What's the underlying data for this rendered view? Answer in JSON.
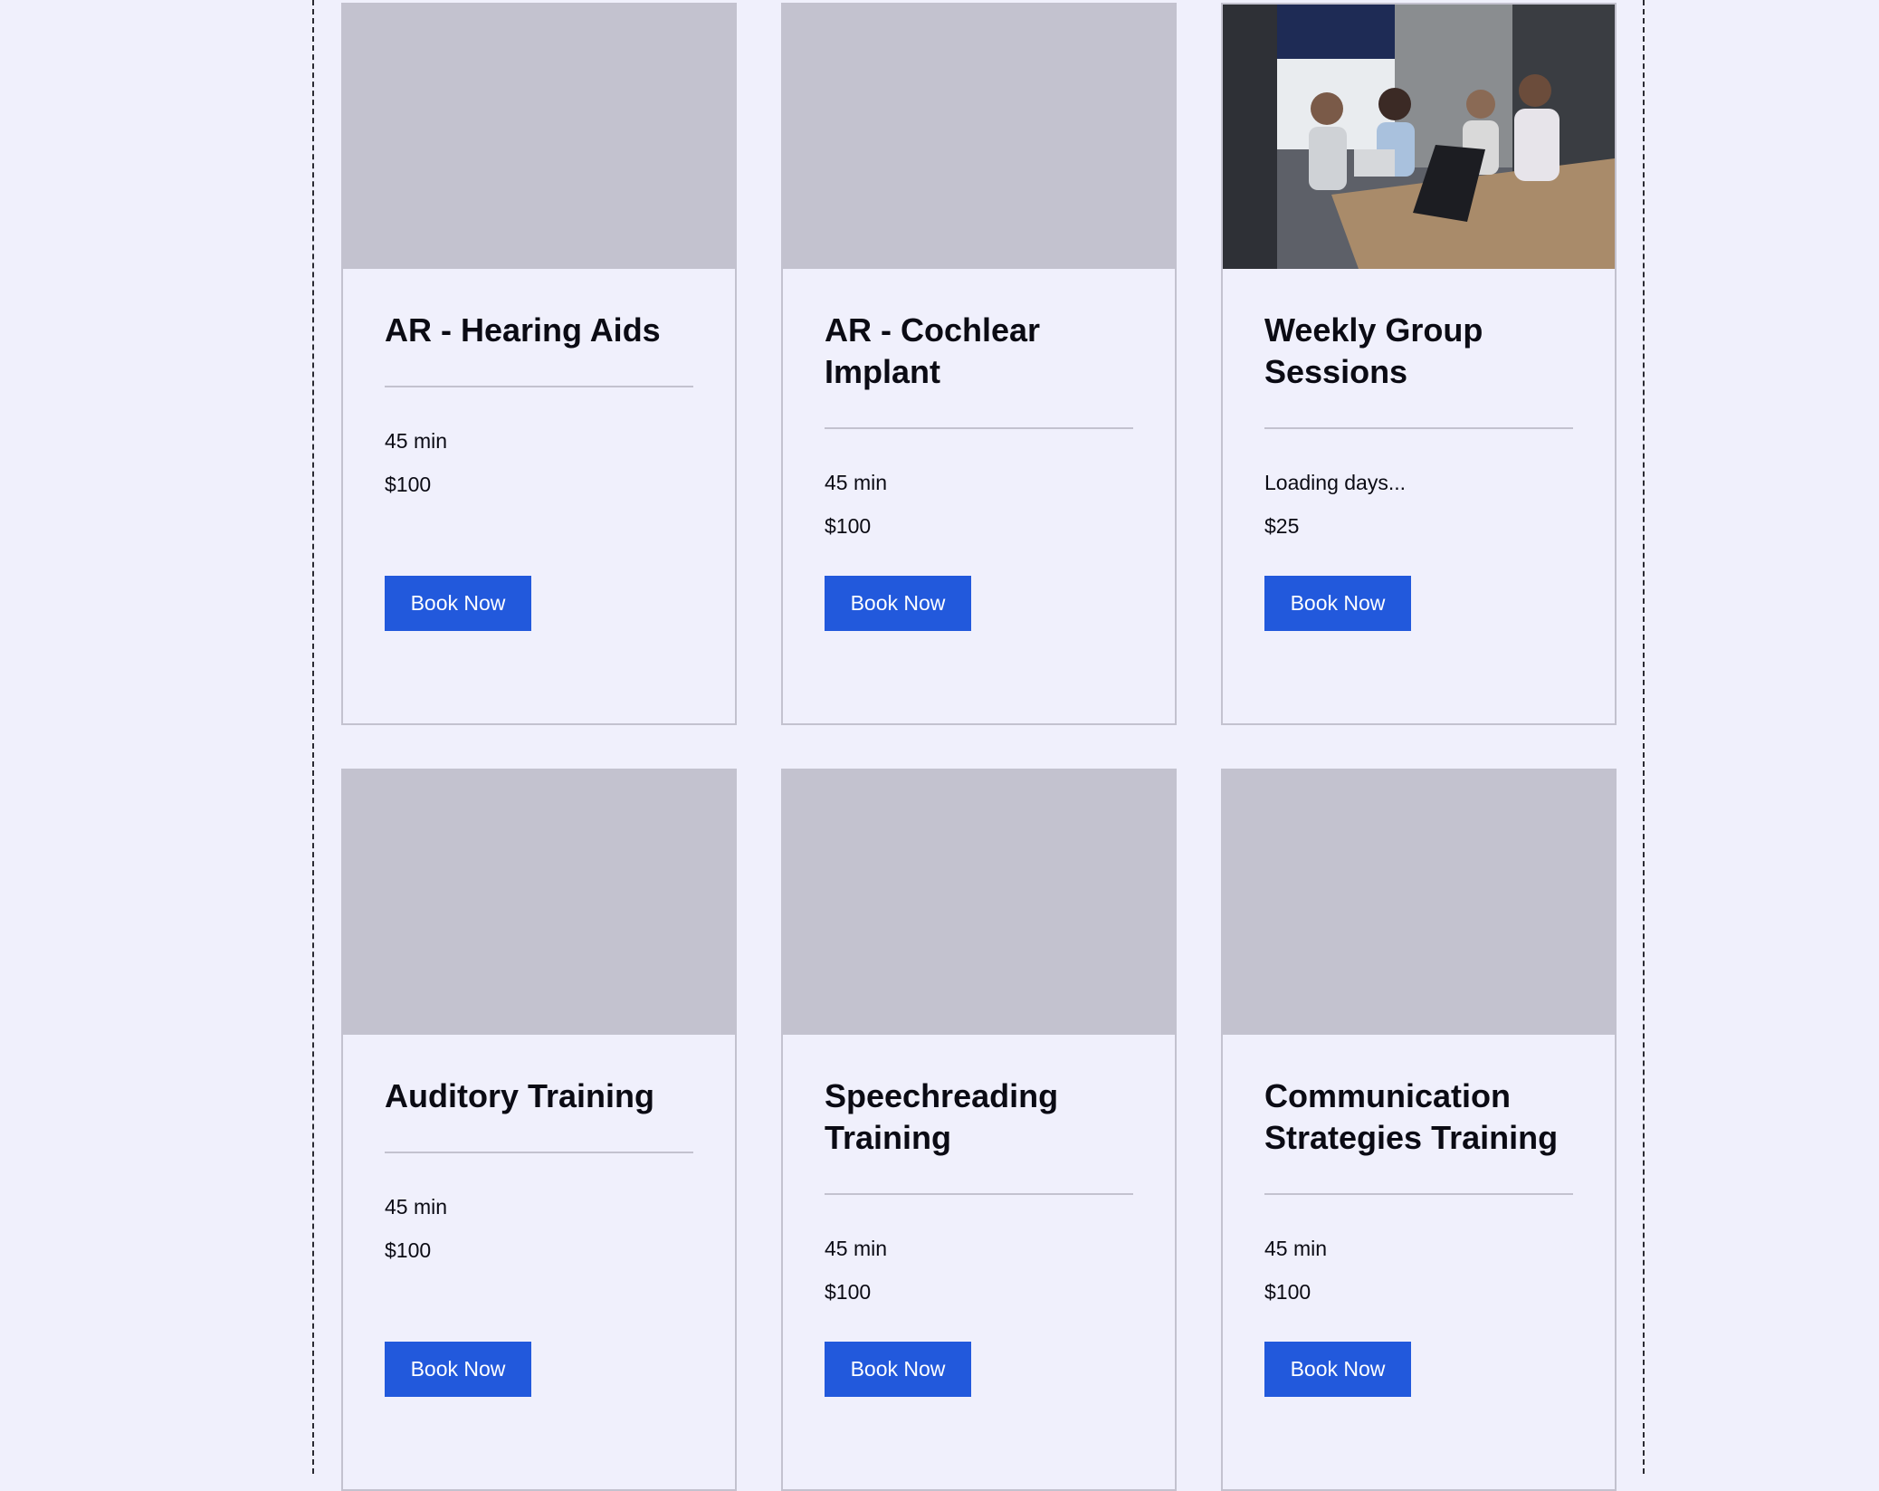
{
  "services": [
    {
      "title": "AR - Hearing Aids",
      "details": [
        "45 min",
        "$100"
      ],
      "button_label": "Book Now",
      "image": "placeholder"
    },
    {
      "title": "AR - Cochlear Implant",
      "details": [
        "45 min",
        "$100"
      ],
      "button_label": "Book Now",
      "image": "placeholder"
    },
    {
      "title": "Weekly Group Sessions",
      "details": [
        "Loading days...",
        "$25"
      ],
      "button_label": "Book Now",
      "image": "meeting-photo"
    },
    {
      "title": "Auditory Training",
      "details": [
        "45 min",
        "$100"
      ],
      "button_label": "Book Now",
      "image": "placeholder"
    },
    {
      "title": "Speechreading Training",
      "details": [
        "45 min",
        "$100"
      ],
      "button_label": "Book Now",
      "image": "placeholder"
    },
    {
      "title": "Communication Strategies Training",
      "details": [
        "45 min",
        "$100"
      ],
      "button_label": "Book Now",
      "image": "placeholder"
    }
  ],
  "colors": {
    "background": "#f0f0fc",
    "placeholder": "#c3c2cf",
    "button": "#2259dc",
    "button_text": "#ffffff",
    "text": "#0b0b14"
  }
}
